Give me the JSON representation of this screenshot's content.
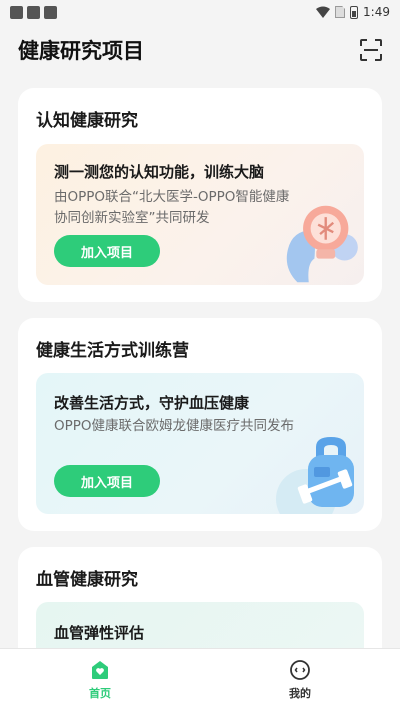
{
  "status_bar": {
    "time": "1:49"
  },
  "header": {
    "title": "健康研究项目"
  },
  "cards": [
    {
      "title": "认知健康研究",
      "inner_title": "测一测您的认知功能，训练大脑",
      "description": "由OPPO联合“北大医学-OPPO智能健康协同创新实验室”共同研发",
      "button": "加入项目"
    },
    {
      "title": "健康生活方式训练营",
      "inner_title": "改善生活方式，守护血压健康",
      "description": "OPPO健康联合欧姆龙健康医疗共同发布",
      "button": "加入项目"
    },
    {
      "title": "血管健康研究",
      "inner_title": "血管弹性评估"
    }
  ],
  "bottom_nav": [
    {
      "label": "首页",
      "icon": "home-heart-icon"
    },
    {
      "label": "我的",
      "icon": "profile-face-icon"
    }
  ],
  "colors": {
    "accent": "#2ecc7a"
  }
}
